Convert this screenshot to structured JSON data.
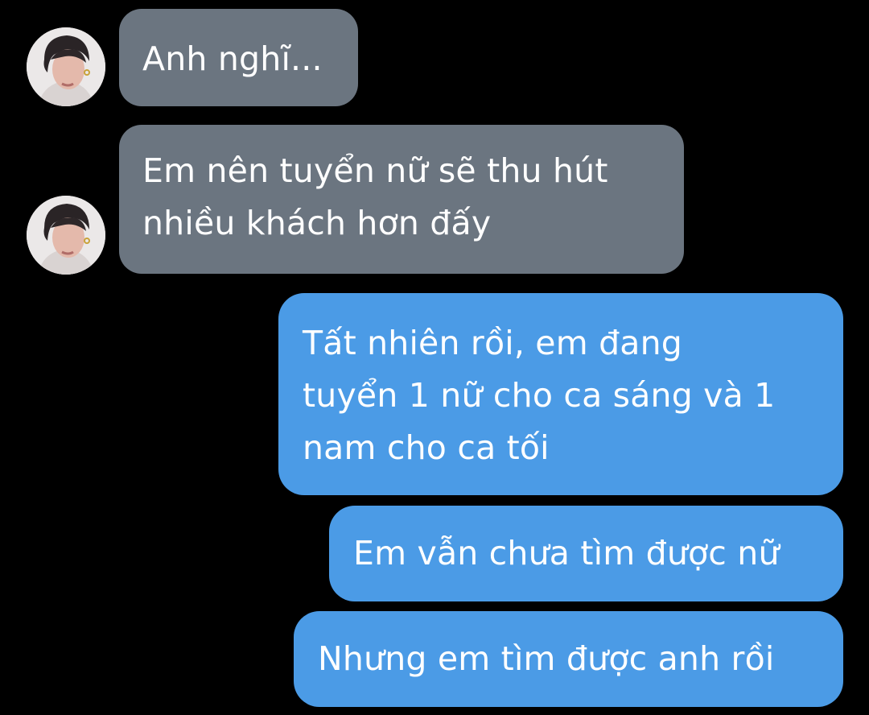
{
  "conversation": {
    "incoming": [
      {
        "lines": [
          "Anh nghĩ..."
        ]
      },
      {
        "lines": [
          "Em nên tuyển nữ sẽ thu hút",
          "nhiều khách hơn đấy"
        ]
      }
    ],
    "outgoing": [
      {
        "lines": [
          "Tất nhiên rồi, em đang",
          "tuyển 1 nữ cho ca sáng và 1",
          "nam cho ca tối"
        ]
      },
      {
        "lines": [
          "Em vẫn chưa tìm được nữ"
        ]
      },
      {
        "lines": [
          "Nhưng em tìm được anh rồi"
        ]
      }
    ]
  },
  "colors": {
    "background": "#000000",
    "incoming_bubble": "#6b7580",
    "outgoing_bubble": "#4b9be6",
    "text": "#ffffff"
  },
  "icons": {
    "avatar": "contact-avatar-photo"
  }
}
